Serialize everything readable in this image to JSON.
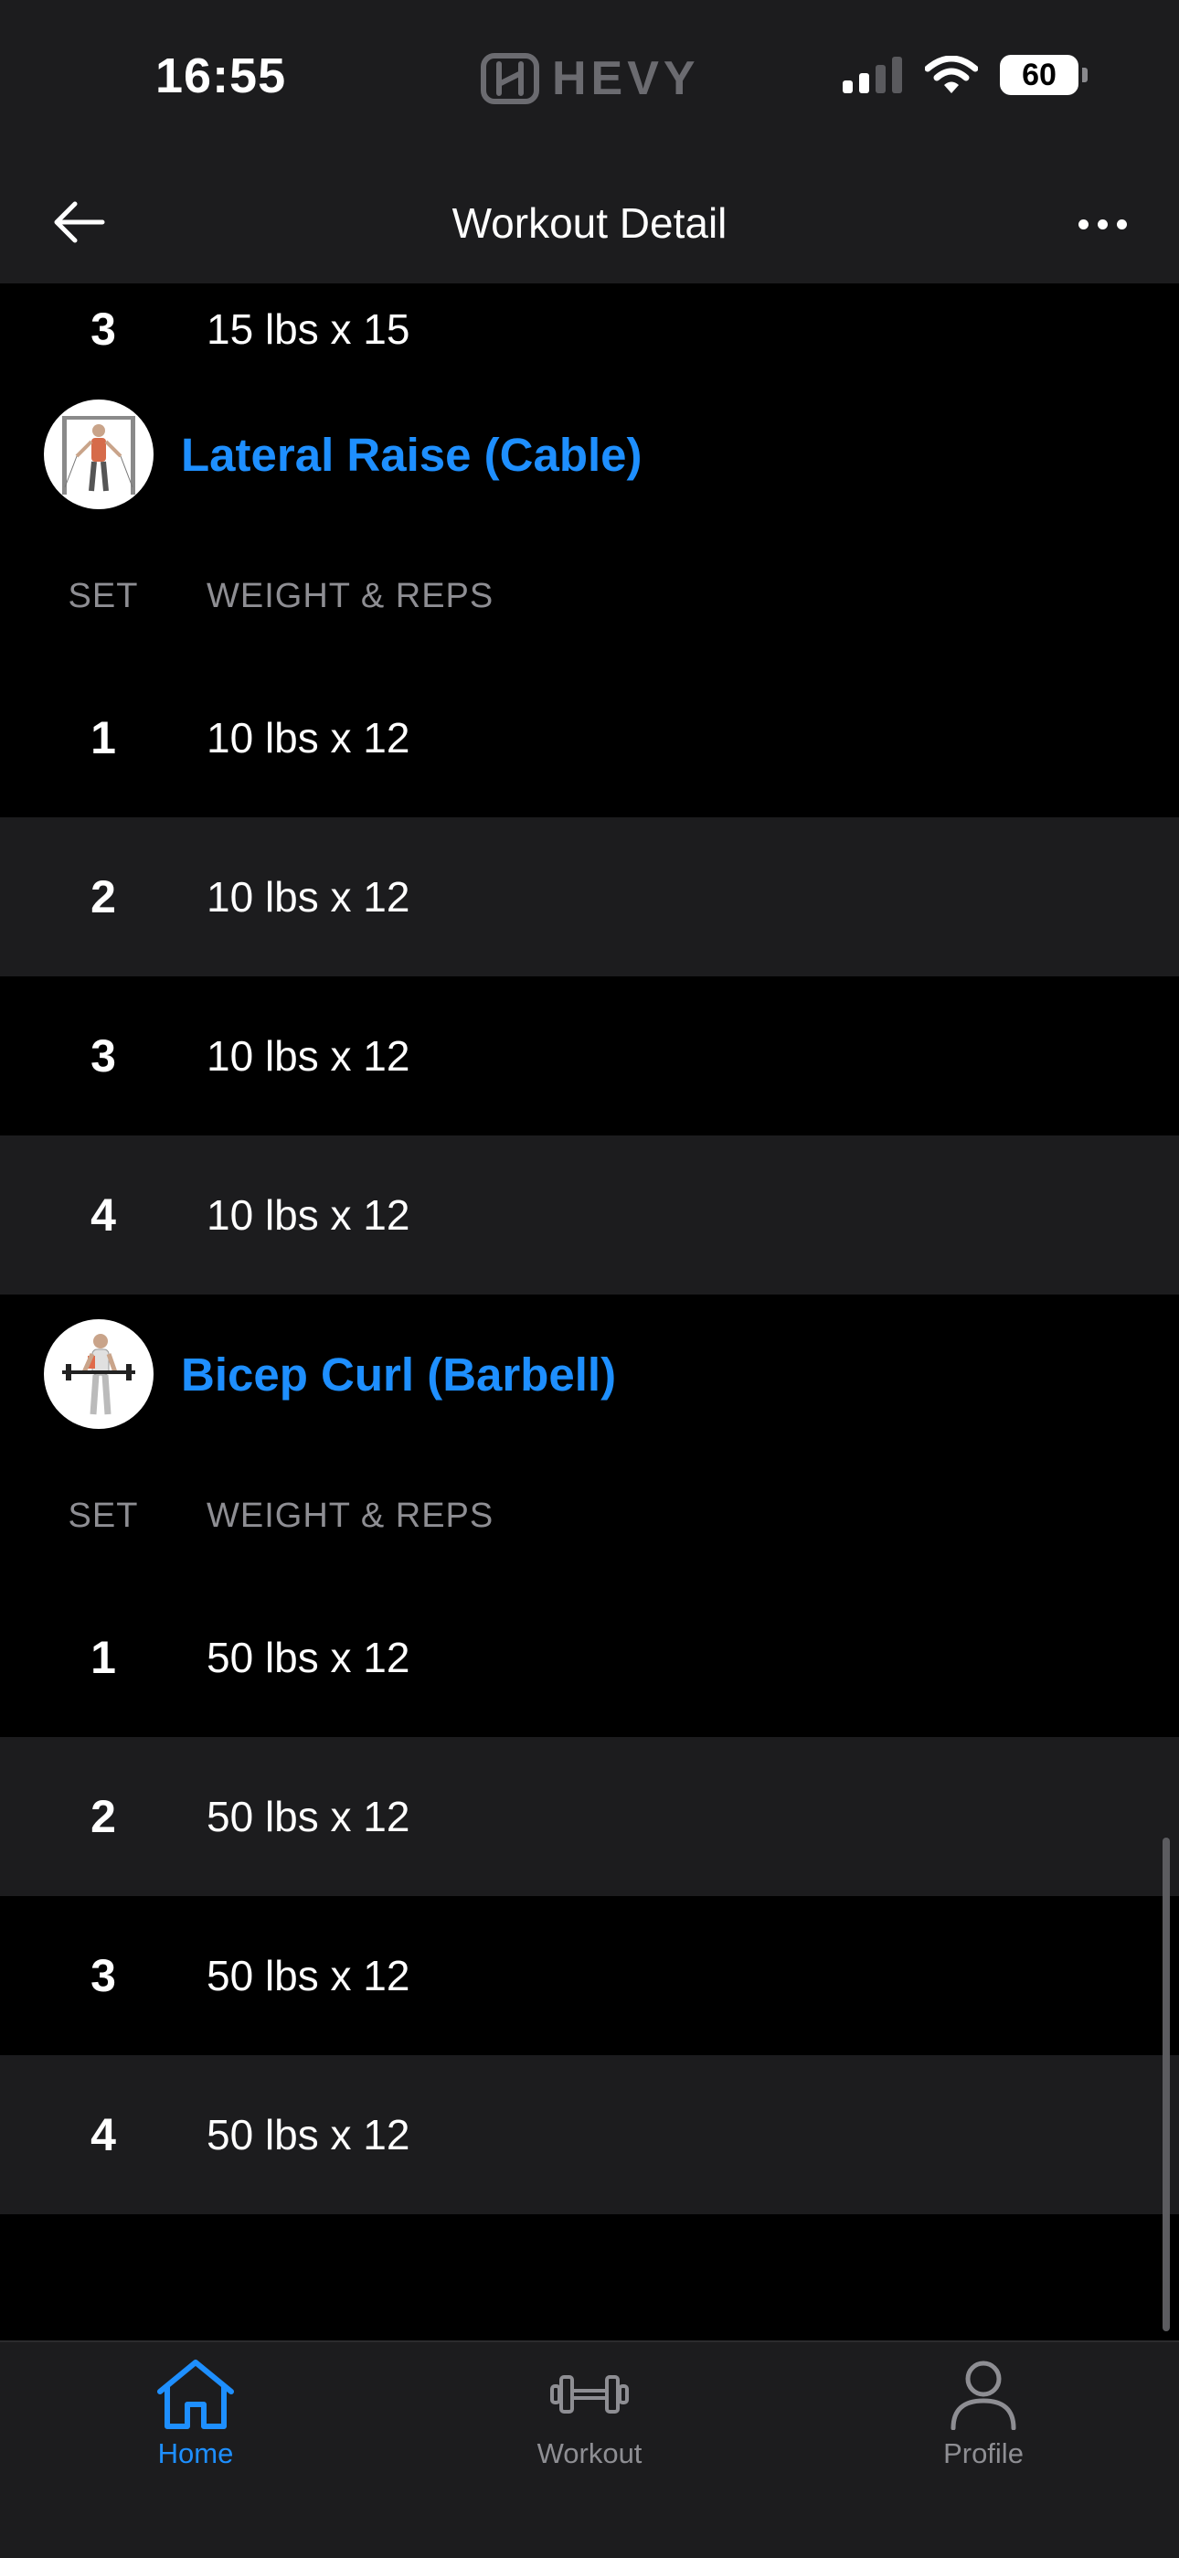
{
  "status_bar": {
    "time": "16:55",
    "brand": "HEVY",
    "battery": "60"
  },
  "header": {
    "title": "Workout Detail"
  },
  "previous_exercise_rows": [
    {
      "set": "3",
      "value": "15 lbs x 15"
    }
  ],
  "exercises": [
    {
      "name": "Lateral Raise (Cable)",
      "columns": {
        "set": "SET",
        "weight_reps": "WEIGHT & REPS"
      },
      "sets": [
        {
          "set": "1",
          "value": "10 lbs x 12"
        },
        {
          "set": "2",
          "value": "10 lbs x 12"
        },
        {
          "set": "3",
          "value": "10 lbs x 12"
        },
        {
          "set": "4",
          "value": "10 lbs x 12"
        }
      ]
    },
    {
      "name": "Bicep Curl (Barbell)",
      "columns": {
        "set": "SET",
        "weight_reps": "WEIGHT & REPS"
      },
      "sets": [
        {
          "set": "1",
          "value": "50 lbs x 12"
        },
        {
          "set": "2",
          "value": "50 lbs x 12"
        },
        {
          "set": "3",
          "value": "50 lbs x 12"
        },
        {
          "set": "4",
          "value": "50 lbs x 12"
        }
      ]
    }
  ],
  "tabs": [
    {
      "label": "Home",
      "icon": "home-icon",
      "active": true
    },
    {
      "label": "Workout",
      "icon": "dumbbell-icon",
      "active": false
    },
    {
      "label": "Profile",
      "icon": "person-icon",
      "active": false
    }
  ],
  "colors": {
    "accent": "#1e8fff",
    "background": "#000000",
    "surface": "#1c1c1e",
    "muted": "#8e8e93"
  }
}
